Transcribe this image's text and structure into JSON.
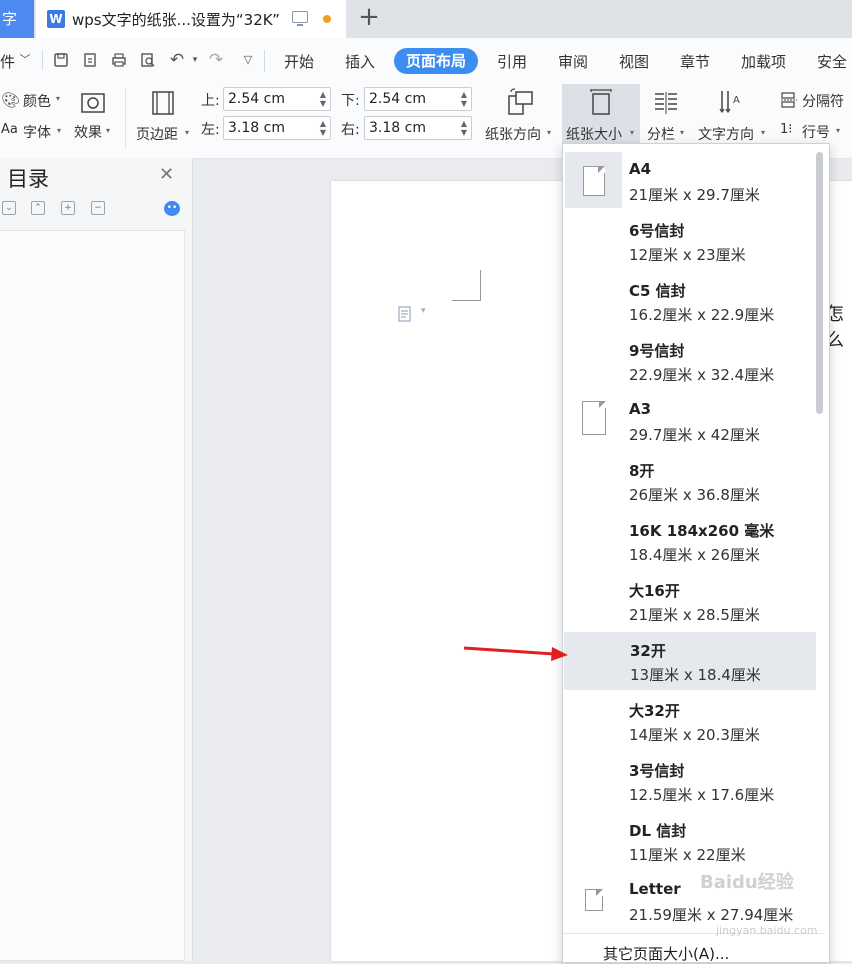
{
  "tabs": {
    "left_partial": "字",
    "doc_title": "wps文字的纸张...设置为“32K”",
    "add_label": "+"
  },
  "menu": {
    "left_partial": "件",
    "items": [
      "开始",
      "插入",
      "页面布局",
      "引用",
      "审阅",
      "视图",
      "章节",
      "加载项",
      "安全"
    ]
  },
  "ribbon": {
    "color_label": "颜色",
    "font_label": "字体",
    "effect_label": "效果",
    "margin_label": "页边距",
    "top_label": "上:",
    "top_value": "2.54 cm",
    "left_label": "左:",
    "left_value": "3.18 cm",
    "bottom_label": "下:",
    "bottom_value": "2.54 cm",
    "right_label": "右:",
    "right_value": "3.18 cm",
    "orientation_label": "纸张方向",
    "papersize_label": "纸张大小",
    "columns_label": "分栏",
    "text_direction_label": "文字方向",
    "separator_label": "分隔符",
    "line_number_label": "行号"
  },
  "nav": {
    "title": "目录"
  },
  "page": {
    "text_partial": "怎么"
  },
  "paper_sizes": [
    {
      "name": "A4",
      "dims": "21厘米 x 29.7厘米",
      "icon": true,
      "selected": true
    },
    {
      "name": "6号信封",
      "dims": "12厘米 x 23厘米",
      "icon": false
    },
    {
      "name": "C5 信封",
      "dims": "16.2厘米 x 22.9厘米",
      "icon": false
    },
    {
      "name": "9号信封",
      "dims": "22.9厘米 x 32.4厘米",
      "icon": false
    },
    {
      "name": "A3",
      "dims": "29.7厘米 x 42厘米",
      "icon": true
    },
    {
      "name": "8开",
      "dims": "26厘米 x 36.8厘米",
      "icon": false
    },
    {
      "name": "16K 184x260 毫米",
      "dims": "18.4厘米 x 26厘米",
      "icon": false
    },
    {
      "name": "大16开",
      "dims": "21厘米 x 28.5厘米",
      "icon": false
    },
    {
      "name": "32开",
      "dims": "13厘米 x 18.4厘米",
      "icon": false,
      "hovered": true
    },
    {
      "name": "大32开",
      "dims": "14厘米 x 20.3厘米",
      "icon": false
    },
    {
      "name": "3号信封",
      "dims": "12.5厘米 x 17.6厘米",
      "icon": false
    },
    {
      "name": "DL 信封",
      "dims": "11厘米 x 22厘米",
      "icon": false
    },
    {
      "name": "Letter",
      "dims": "21.59厘米 x 27.94厘米",
      "icon": true
    }
  ],
  "dropdown_footer": "其它页面大小(A)...",
  "watermark": {
    "logo": "Baidu经验",
    "url": "jingyan.baidu.com"
  },
  "colors": {
    "accent": "#3b8df2",
    "arrow": "#e02020",
    "hover": "#e5e8ec"
  }
}
